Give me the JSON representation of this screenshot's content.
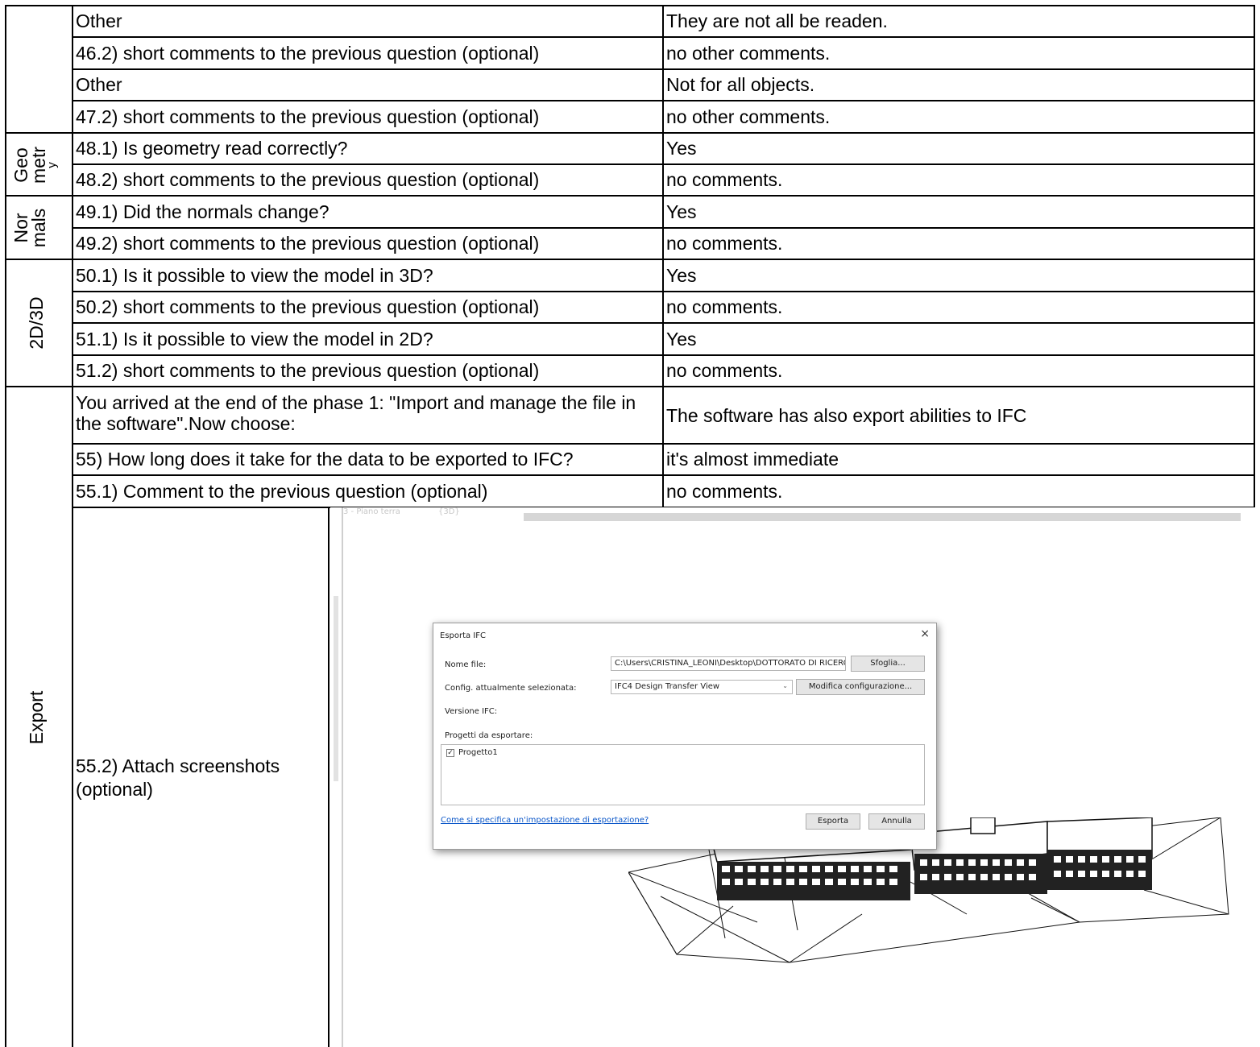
{
  "rows": [
    {
      "question": "Other",
      "answer": "They are not all be readen."
    },
    {
      "question": "46.2) short comments to the previous question (optional)",
      "answer": "no other comments."
    },
    {
      "question": "Other",
      "answer": "Not for all objects."
    },
    {
      "question": "47.2) short comments to the previous question (optional)",
      "answer": "no other comments."
    },
    {
      "question": "48.1) Is geometry read correctly?",
      "answer": "Yes"
    },
    {
      "question": "48.2) short comments to the previous question (optional)",
      "answer": "no comments."
    },
    {
      "question": "49.1) Did the normals change?",
      "answer": "Yes"
    },
    {
      "question": "49.2) short comments to the previous question (optional)",
      "answer": "no comments."
    },
    {
      "question": "50.1) Is it possible to view the model in 3D?",
      "answer": "Yes"
    },
    {
      "question": "50.2) short comments to the previous question (optional)",
      "answer": "no comments."
    },
    {
      "question": "51.1) Is it possible to view the model in 2D?",
      "answer": "Yes"
    },
    {
      "question": "51.2) short comments to the previous question (optional)",
      "answer": "no comments."
    },
    {
      "question": "You arrived at the end of the phase 1: \"Import and manage the file in the software\".Now choose:",
      "answer": "The software has also export abilities to IFC"
    },
    {
      "question": "55) How long does it take for the data to be exported to IFC?",
      "answer": "it's almost immediate"
    },
    {
      "question": "55.1) Comment to the previous question (optional)",
      "answer": "no comments."
    }
  ],
  "attach_label": "55.2) Attach screenshots (optional)",
  "sections": {
    "geometry": [
      "Geo",
      "metr",
      "y"
    ],
    "normals": [
      "Nor",
      "mals"
    ],
    "view": "2D/3D",
    "export": "Export"
  },
  "screenshot": {
    "tabs": [
      "3 - Piano terra",
      "{3D}"
    ],
    "dialog": {
      "title": "Esporta IFC",
      "close": "×",
      "file_label": "Nome file:",
      "file_value": "C:\\Users\\CRISTINA_LEONI\\Desktop\\DOTTORATO DI RICERCA C",
      "browse_button": "Sfoglia...",
      "config_label": "Config. attualmente selezionata:",
      "config_value": "IFC4 Design Transfer View",
      "edit_config_button": "Modifica configurazione...",
      "version_label": "Versione IFC:",
      "projects_label": "Progetti da esportare:",
      "project_item": "Progetto1",
      "help_link": "Come si specifica un'impostazione di esportazione?",
      "export_button": "Esporta",
      "cancel_button": "Annulla"
    }
  }
}
